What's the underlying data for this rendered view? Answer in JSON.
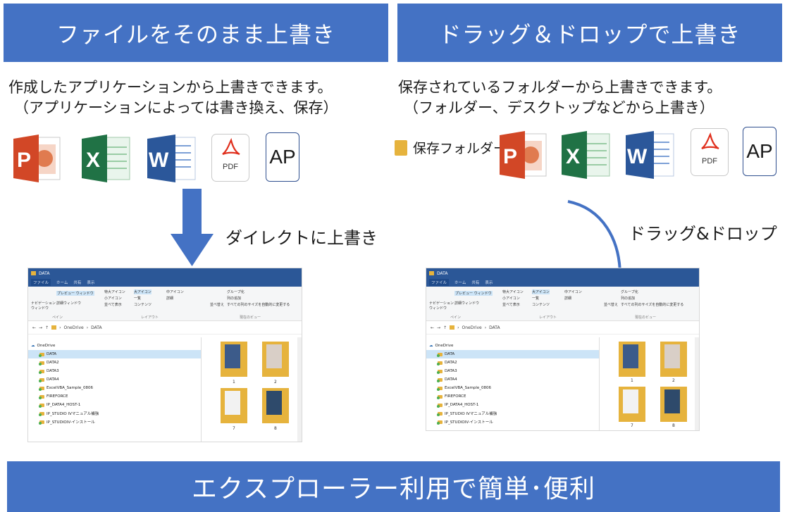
{
  "left": {
    "banner": "ファイルをそのまま上書き",
    "desc_line1": "作成したアプリケーションから上書きできます。",
    "desc_line2": "（アプリケーションによっては書き換え、保存）",
    "caption": "ダイレクトに上書き",
    "icons": [
      "powerpoint-icon",
      "excel-icon",
      "word-icon",
      "pdf-icon",
      "ap-icon"
    ],
    "ap_label": "AP",
    "pdf_label": "PDF"
  },
  "right": {
    "banner": "ドラッグ＆ドロップで上書き",
    "desc_line1": "保存されているフォルダーから上書きできます。",
    "desc_line2": "（フォルダー、デスクトップなどから上書き）",
    "folder_label": "保存フォルダー",
    "caption": "ドラッグ&ドロップ",
    "ap_label": "AP",
    "pdf_label": "PDF"
  },
  "bottom": {
    "banner": "エクスプローラー利用で簡単･便利"
  },
  "explorer": {
    "title": "DATA",
    "tabs": [
      "ファイル",
      "ホーム",
      "共有",
      "表示"
    ],
    "ribbon": {
      "nav_pane": "ナビゲーション\nウィンドウ",
      "preview": "プレビュー ウィンドウ",
      "details_pane": "詳細ウィンドウ",
      "pane_group": "ペイン",
      "xl_icons": "特大アイコン",
      "l_icons": "大アイコン",
      "m_icons": "中アイコン",
      "s_icons": "小アイコン",
      "list": "一覧",
      "details": "詳細",
      "tiles": "並べて表示",
      "content": "コンテンツ",
      "layout_group": "レイアウト",
      "sort": "並べ替え",
      "group_by": "グループ化",
      "add_col": "列の追加",
      "fit_cols": "すべての列のサイズを自動的に変更する",
      "view_group": "現在のビュー"
    },
    "address": [
      "OneDrive",
      "DATA"
    ],
    "tree": [
      "OneDrive",
      "DATA",
      "DATA2",
      "DATA3",
      "DATA4",
      "ExcelVBA_Sample_0806",
      "FIREFORCE",
      "IP_DATA4_HOST-1",
      "IP_STUDIO IVマニュアル補強",
      "IP_STUDIOIV-インストール"
    ],
    "files": [
      "1",
      "2",
      "7",
      "8"
    ]
  },
  "colors": {
    "banner": "#4472c4",
    "arrow": "#4472c4",
    "folder": "#e6b33d"
  }
}
